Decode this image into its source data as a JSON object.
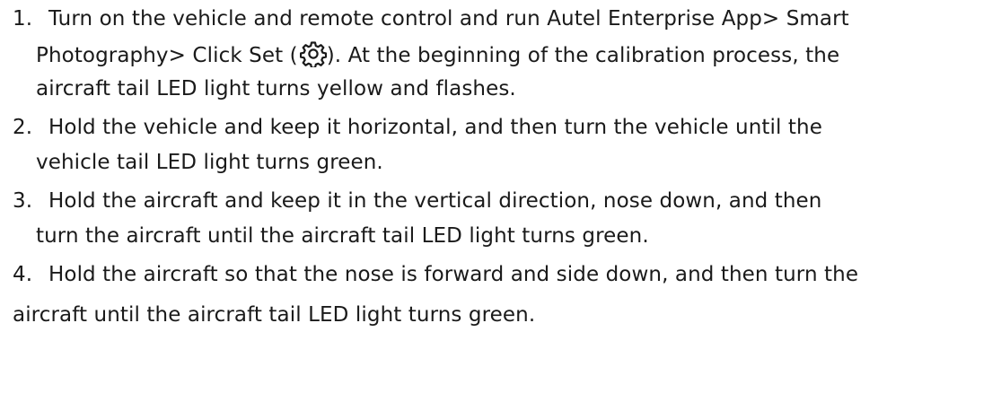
{
  "steps": [
    {
      "number": "1.",
      "line1": "Turn on the vehicle and remote control and run Autel Enterprise App> Smart",
      "line2_before_icon": "Photography> Click Set (",
      "icon": "settings-gear-icon",
      "line2_after_icon": "). At the beginning of the calibration process, the",
      "line3": "aircraft tail LED light turns yellow and flashes."
    },
    {
      "number": "2.",
      "line1": "Hold the vehicle and keep it horizontal, and then turn the vehicle until the",
      "line2": "vehicle tail LED light turns green."
    },
    {
      "number": "3.",
      "line1": "Hold the aircraft and keep it in the vertical direction, nose down, and then",
      "line2": "turn the aircraft until the aircraft tail LED light turns green."
    },
    {
      "number": "4.",
      "line1": "Hold the aircraft so that the nose is forward and side down, and then turn the",
      "line2": "aircraft until the aircraft tail LED light turns green."
    }
  ]
}
